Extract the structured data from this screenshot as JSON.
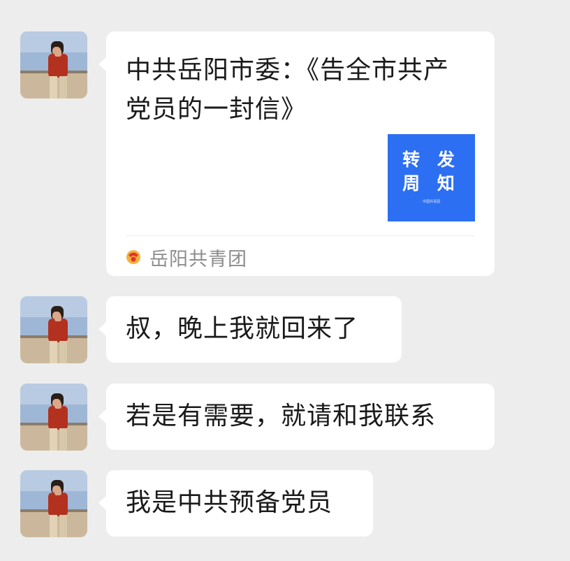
{
  "messages": [
    {
      "type": "link-card",
      "title": "中共岳阳市委：《告全市共产党员的一封信》",
      "thumbnail": {
        "line1": "转 发",
        "line2": "周 知",
        "small_text": "中国共青团"
      },
      "source": "岳阳共青团"
    },
    {
      "type": "text",
      "text": "叔，晚上我就回来了"
    },
    {
      "type": "text",
      "text": "若是有需要，就请和我联系"
    },
    {
      "type": "text",
      "text": "我是中共预备党员"
    }
  ],
  "colors": {
    "background": "#ededed",
    "bubble": "#ffffff",
    "thumbnail": "#2d6ff2",
    "source_text": "#8c8c8c"
  },
  "icons": {
    "source_icon": "youth-league-emblem-icon"
  }
}
